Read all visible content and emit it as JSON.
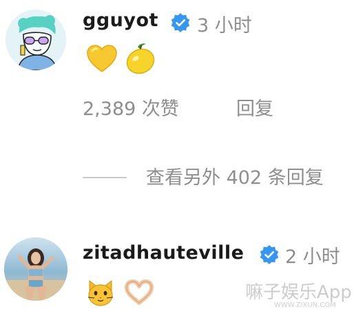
{
  "comments": [
    {
      "username": "gguyot",
      "verified": true,
      "time": "3 小时",
      "emojis": [
        "yellow-heart",
        "lemon"
      ],
      "likes": "2,389 次赞",
      "reply_label": "回复"
    },
    {
      "username": "zitadhauteville",
      "verified": true,
      "time": "2 小时",
      "emojis": [
        "cat-face",
        "heart-hands"
      ]
    }
  ],
  "view_more_replies": "查看另外 402 条回复",
  "watermark": {
    "text": "嘛子娱乐App",
    "url": "WWW.ZIXUN.COM"
  },
  "colors": {
    "username": "#1b1b1b",
    "secondary": "#8e8e8e",
    "verified_blue": "#3797f0"
  }
}
